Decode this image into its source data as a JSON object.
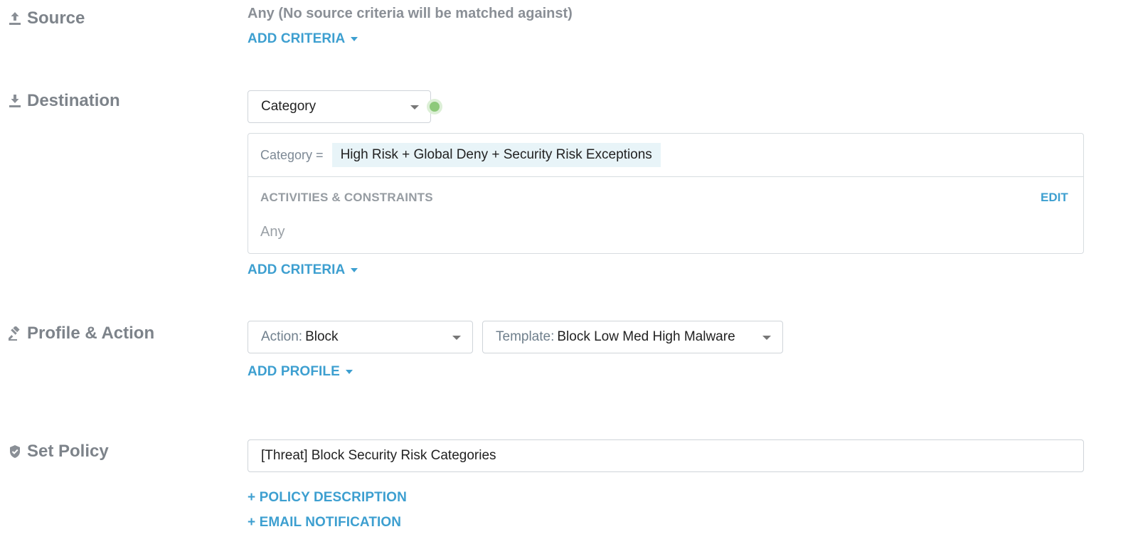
{
  "source": {
    "label": "Source",
    "icon": "upload-icon",
    "value_text": "Any (No source criteria will be matched against)",
    "add_criteria": "ADD CRITERIA"
  },
  "destination": {
    "label": "Destination",
    "icon": "download-icon",
    "type_select": "Category",
    "status_color": "#8dc97a",
    "criteria": {
      "key": "Category =",
      "value": "High Risk + Global Deny + Security Risk Exceptions"
    },
    "activities": {
      "heading": "ACTIVITIES & CONSTRAINTS",
      "edit": "EDIT",
      "value": "Any"
    },
    "add_criteria": "ADD CRITERIA"
  },
  "profile_action": {
    "label": "Profile & Action",
    "icon": "gavel-icon",
    "action": {
      "key": "Action:",
      "value": "Block"
    },
    "template": {
      "key": "Template:",
      "value": "Block Low Med High Malware"
    },
    "add_profile": "ADD PROFILE"
  },
  "set_policy": {
    "label": "Set Policy",
    "icon": "shield-check-icon",
    "policy_name": "[Threat] Block Security Risk Categories",
    "policy_description_link": "+ POLICY DESCRIPTION",
    "email_notification_link": "+ EMAIL NOTIFICATION"
  },
  "colors": {
    "accent": "#3d9fd0",
    "label_gray": "#7d838a",
    "chip_bg": "#e8f4f8"
  }
}
